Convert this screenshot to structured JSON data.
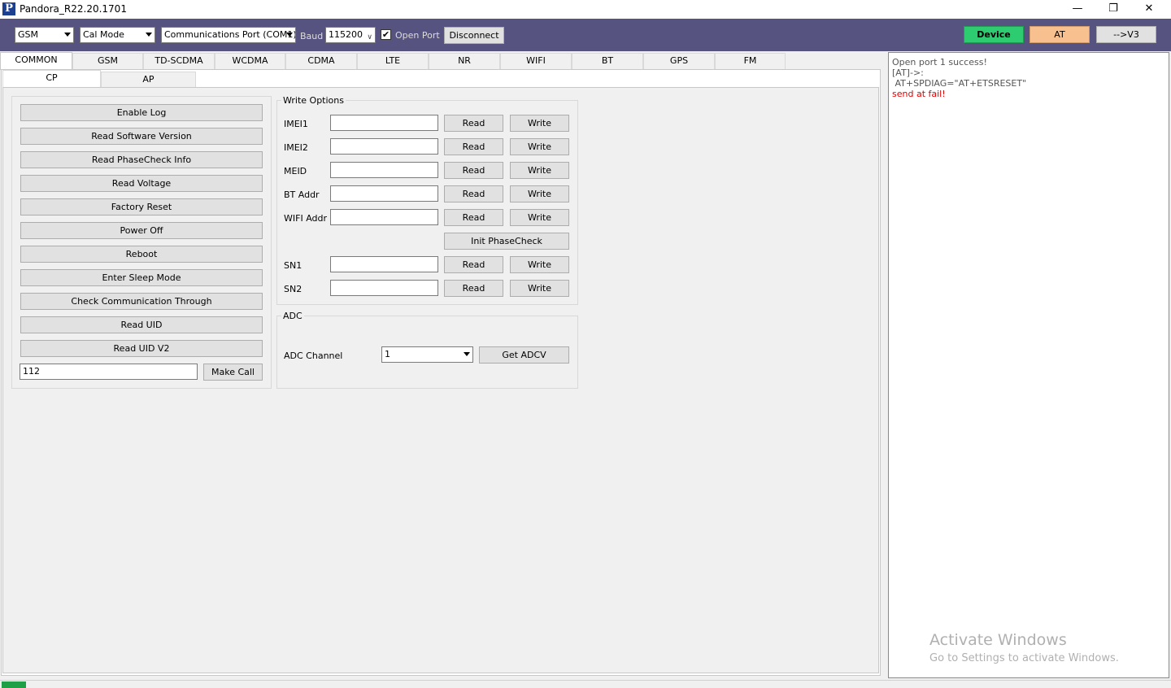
{
  "window": {
    "title": "Pandora_R22.20.1701",
    "app_icon_letter": "P",
    "minimize_glyph": "—",
    "restore_glyph": "❐",
    "close_glyph": "✕"
  },
  "toolbar": {
    "mode_select": "GSM",
    "cal_mode_select": "Cal Mode",
    "port_select": "Communications Port (COM1)",
    "baud_label": "Baud",
    "baud_select": "115200",
    "open_port_label": "Open Port",
    "open_port_checked": "✔",
    "disconnect_label": "Disconnect",
    "device_label": "Device",
    "at_label": "AT",
    "v3_label": "-->V3",
    "colors": {
      "toolbar_bg": "#575380",
      "device": "#2ecc71",
      "at": "#f8c08f"
    }
  },
  "tabs": [
    "COMMON",
    "GSM",
    "TD-SCDMA",
    "WCDMA",
    "CDMA",
    "LTE",
    "NR",
    "WIFI",
    "BT",
    "GPS",
    "FM"
  ],
  "subtabs": [
    "CP",
    "AP"
  ],
  "cp": {
    "buttons": [
      "Enable Log",
      "Read Software Version",
      "Read PhaseCheck Info",
      "Read Voltage",
      "Factory Reset",
      "Power Off",
      "Reboot",
      "Enter Sleep Mode",
      "Check Communication Through",
      "Read UID",
      "Read UID V2"
    ],
    "call_number": "112",
    "make_call_label": "Make Call"
  },
  "write_options": {
    "title": "Write Options",
    "read_label": "Read",
    "write_label": "Write",
    "fields": [
      "IMEI1",
      "IMEI2",
      "MEID",
      "BT Addr",
      "WIFI Addr"
    ],
    "init_phasecheck_label": "Init PhaseCheck",
    "sn_fields": [
      "SN1",
      "SN2"
    ]
  },
  "adc": {
    "title": "ADC",
    "channel_label": "ADC Channel",
    "channel_value": "1",
    "get_adcv_label": "Get ADCV"
  },
  "log": {
    "lines": [
      {
        "text": "Open port 1 success!",
        "color": "#555555"
      },
      {
        "text": "[AT]->:",
        "color": "#555555"
      },
      {
        "text": " AT+SPDIAG=\"AT+ETSRESET\"",
        "color": "#555555"
      },
      {
        "text": "send at fail!",
        "color": "#e00000"
      }
    ]
  },
  "watermark": {
    "title": "Activate Windows",
    "subtitle": "Go to Settings to activate Windows."
  }
}
